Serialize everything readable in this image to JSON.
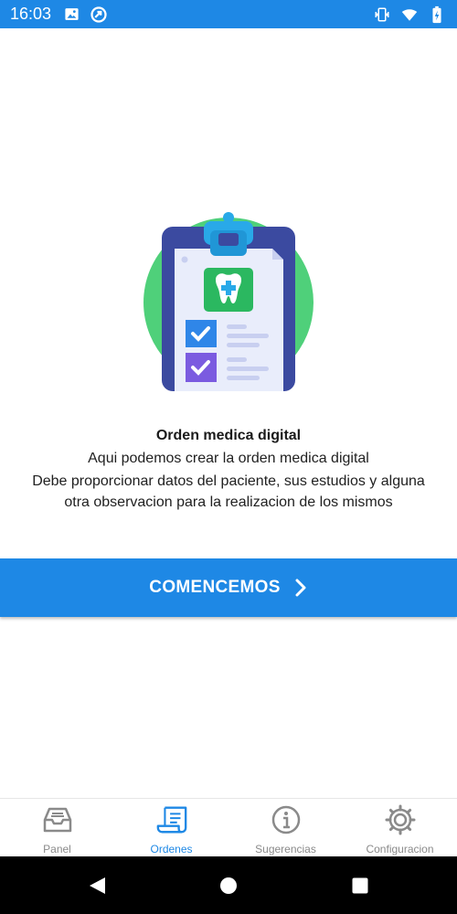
{
  "status_bar": {
    "time": "16:03",
    "left_icons": [
      "image-icon",
      "at-sign-icon"
    ],
    "right_icons": [
      "vibrate-icon",
      "wifi-icon",
      "battery-charging-icon"
    ]
  },
  "onboarding": {
    "title": "Orden medica digital",
    "subtitle": "Aqui podemos crear la orden medica digital",
    "description": "Debe proporcionar datos del paciente, sus estudios y alguna otra observacion para la realizacion de los mismos",
    "illustration": "clipboard-tooth-icon"
  },
  "cta": {
    "label": "COMENCEMOS",
    "icon": "chevron-right-icon",
    "color": "#1e88e5"
  },
  "bottom_nav": {
    "active_index": 1,
    "active_color": "#1e88e5",
    "items": [
      {
        "label": "Panel",
        "icon": "inbox-tray-icon"
      },
      {
        "label": "Ordenes",
        "icon": "receipt-icon"
      },
      {
        "label": "Sugerencias",
        "icon": "info-icon"
      },
      {
        "label": "Configuracion",
        "icon": "gear-icon"
      }
    ]
  },
  "system_nav": {
    "buttons": [
      "back-icon",
      "home-icon",
      "recents-icon"
    ]
  }
}
